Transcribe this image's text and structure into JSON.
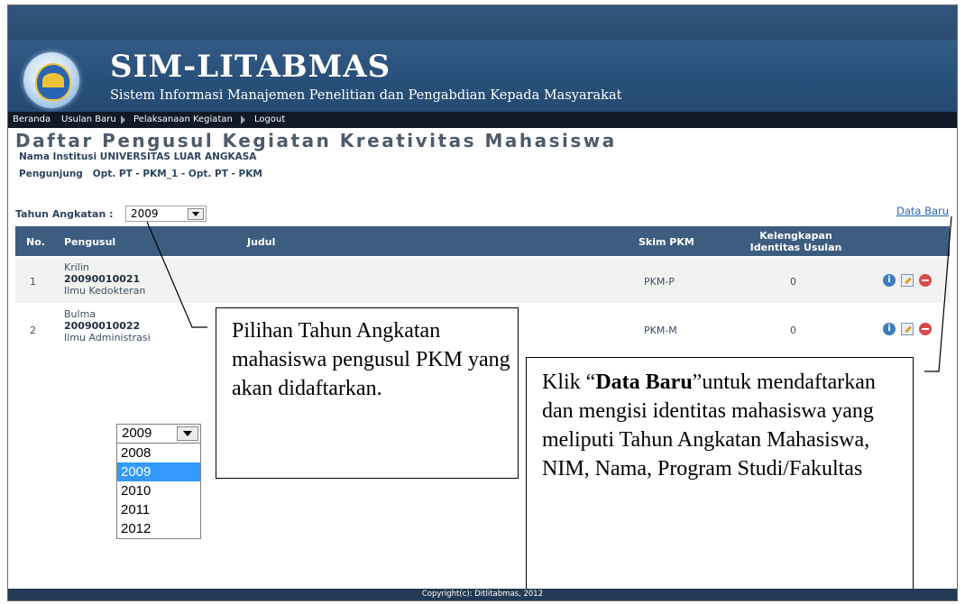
{
  "header": {
    "title": "SIM-LITABMAS",
    "subtitle": "Sistem Informasi Manajemen Penelitian dan Pengabdian Kepada Masyarakat"
  },
  "nav": {
    "items": [
      "Beranda",
      "Usulan Baru",
      "Pelaksanaan Kegiatan",
      "Logout"
    ]
  },
  "page": {
    "title": "Daftar Pengusul Kegiatan Kreativitas Mahasiswa",
    "institution": "Nama Institusi UNIVERSITAS LUAR ANGKASA",
    "visitor": "Pengunjung   Opt. PT - PKM_1 - Opt. PT - PKM"
  },
  "filter": {
    "label": "Tahun Angkatan :",
    "selected": "2009"
  },
  "data_baru_label": "Data Baru",
  "table": {
    "headers": [
      "No.",
      "Pengusul",
      "Judul",
      "Skim PKM",
      "Kelengkapan",
      "Identitas Usulan"
    ],
    "rows": [
      {
        "no": "1",
        "name": "Krilin",
        "nim": "20090010021",
        "prodi": "Ilmu Kedokteran",
        "judul": "",
        "skim": "PKM-P",
        "kelengkapan": "0"
      },
      {
        "no": "2",
        "name": "Bulma",
        "nim": "20090010022",
        "prodi": "Ilmu Administrasi",
        "judul": "",
        "skim": "PKM-M",
        "kelengkapan": "0"
      }
    ]
  },
  "dropdown": {
    "value": "2009",
    "options": [
      "2008",
      "2009",
      "2010",
      "2011",
      "2012"
    ],
    "selected_index": 1
  },
  "callouts": {
    "left": "Pilihan Tahun Angkatan mahasiswa pengusul PKM yang akan didaftarkan.",
    "right_open": "Klik “",
    "right_bold": "Data Baru",
    "right_rest": "”untuk mendaftarkan dan mengisi identitas mahasiswa yang meliputi Tahun Angkatan Mahasiswa, NIM, Nama, Program Studi/Fakultas"
  },
  "footer": "Copyright(c): Ditlitabmas, 2012",
  "colors": {
    "banner": "#29507a",
    "navbar": "#101a26",
    "table_header": "#3d5d80",
    "row_alt": "#f2f2f0",
    "selected_option": "#3399ff",
    "link": "#2566b8"
  },
  "icons": [
    "info-icon",
    "edit-icon",
    "delete-icon",
    "dropdown-arrow-icon",
    "logo-emblem"
  ]
}
